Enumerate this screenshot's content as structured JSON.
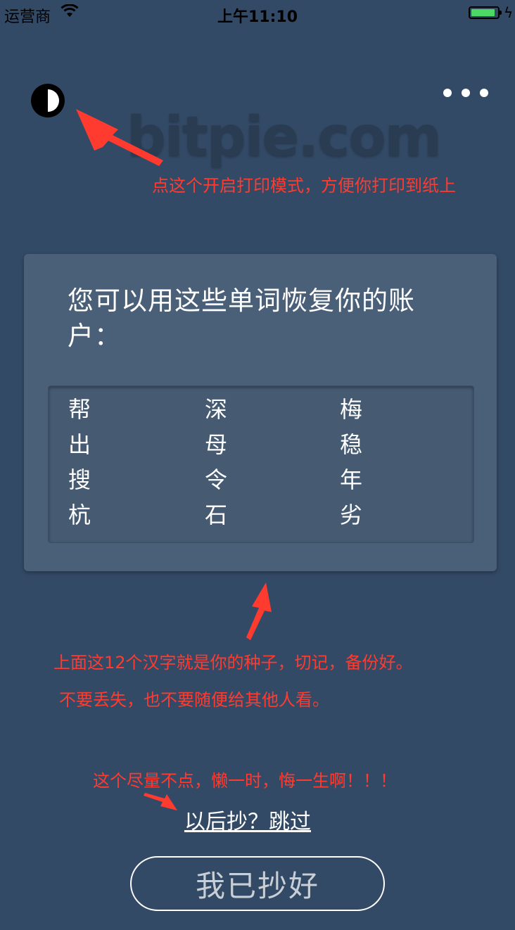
{
  "status_bar": {
    "carrier": "运营商",
    "time": "上午11:10",
    "battery_color": "#4cd964"
  },
  "header": {
    "contrast_icon": "contrast-icon",
    "more_icon": "more-dots-icon",
    "watermark": "bitpie.com"
  },
  "annotations": {
    "print_mode": "点这个开启打印模式，方便你打印到纸上",
    "seed_line1": "上面这12个汉字就是你的种子，切记，备份好。",
    "seed_line2": "不要丢失，也不要随便给其他人看。",
    "skip_warning": "这个尽量不点，懒一时，悔一生啊！！！",
    "color": "#ff3b30"
  },
  "card": {
    "title": "您可以用这些单词恢复你的账户：",
    "words": [
      "帮",
      "深",
      "梅",
      "出",
      "母",
      "稳",
      "搜",
      "令",
      "年",
      "杭",
      "石",
      "劣"
    ]
  },
  "actions": {
    "skip_label": "以后抄？跳过",
    "done_label": "我已抄好"
  }
}
